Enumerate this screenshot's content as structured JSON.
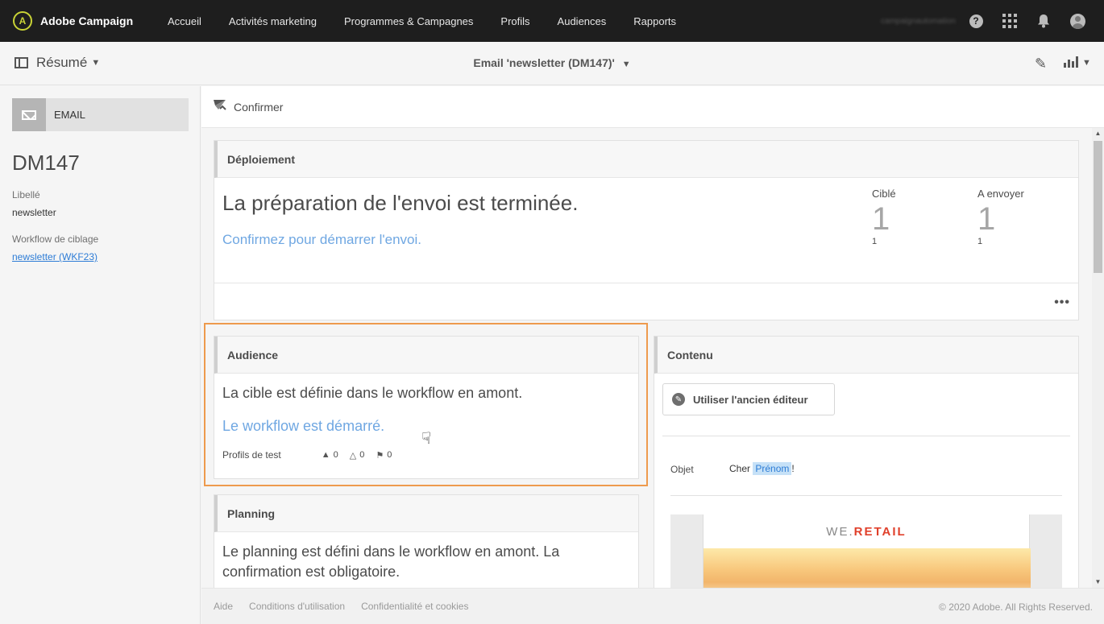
{
  "topbar": {
    "brand_logo": "A",
    "brand": "Adobe Campaign",
    "nav": [
      "Accueil",
      "Activités marketing",
      "Programmes & Campagnes",
      "Profils",
      "Audiences",
      "Rapports"
    ],
    "username": "campaignautomation",
    "help_glyph": "?"
  },
  "header": {
    "summary_label": "Résumé",
    "email_title": "Email 'newsletter (DM147)'",
    "edit_glyph": "✎"
  },
  "sidebar": {
    "channel": "EMAIL",
    "id": "DM147",
    "label_title": "Libellé",
    "label_value": "newsletter",
    "workflow_title": "Workflow de ciblage",
    "workflow_link": "newsletter (WKF23)"
  },
  "actionbar": {
    "confirm_label": "Confirmer"
  },
  "deployment": {
    "title": "Déploiement",
    "status": "La préparation de l'envoi est terminée.",
    "link": "Confirmez pour démarrer l'envoi.",
    "targeted_label": "Ciblé",
    "targeted_value": "1",
    "targeted_sub": "1",
    "to_send_label": "A envoyer",
    "to_send_value": "1",
    "to_send_sub": "1",
    "more_glyph": "•••"
  },
  "audience": {
    "title": "Audience",
    "text": "La cible est définie dans le workflow en amont.",
    "link": "Le workflow est démarré.",
    "test_profiles_label": "Profils de test",
    "counts": [
      "0",
      "0",
      "0"
    ]
  },
  "planning": {
    "title": "Planning",
    "text": "Le planning est défini dans le workflow en amont. La confirmation est obligatoire."
  },
  "content": {
    "title": "Contenu",
    "old_editor_label": "Utiliser l'ancien éditeur",
    "subject_label": "Objet",
    "subject_prefix": "Cher",
    "subject_token": "Prénom",
    "subject_suffix": "!",
    "preview_brand_prefix": "WE.",
    "preview_brand_accent": "RETAIL"
  },
  "footer": {
    "links": [
      "Aide",
      "Conditions d'utilisation",
      "Confidentialité et cookies"
    ],
    "copyright": "© 2020 Adobe. All Rights Reserved."
  },
  "colors": {
    "topbar_bg": "#1e1e1e",
    "link_blue": "#6fa7e2",
    "highlight_orange": "#ee9a4d",
    "brand_accent": "#e0402b"
  }
}
